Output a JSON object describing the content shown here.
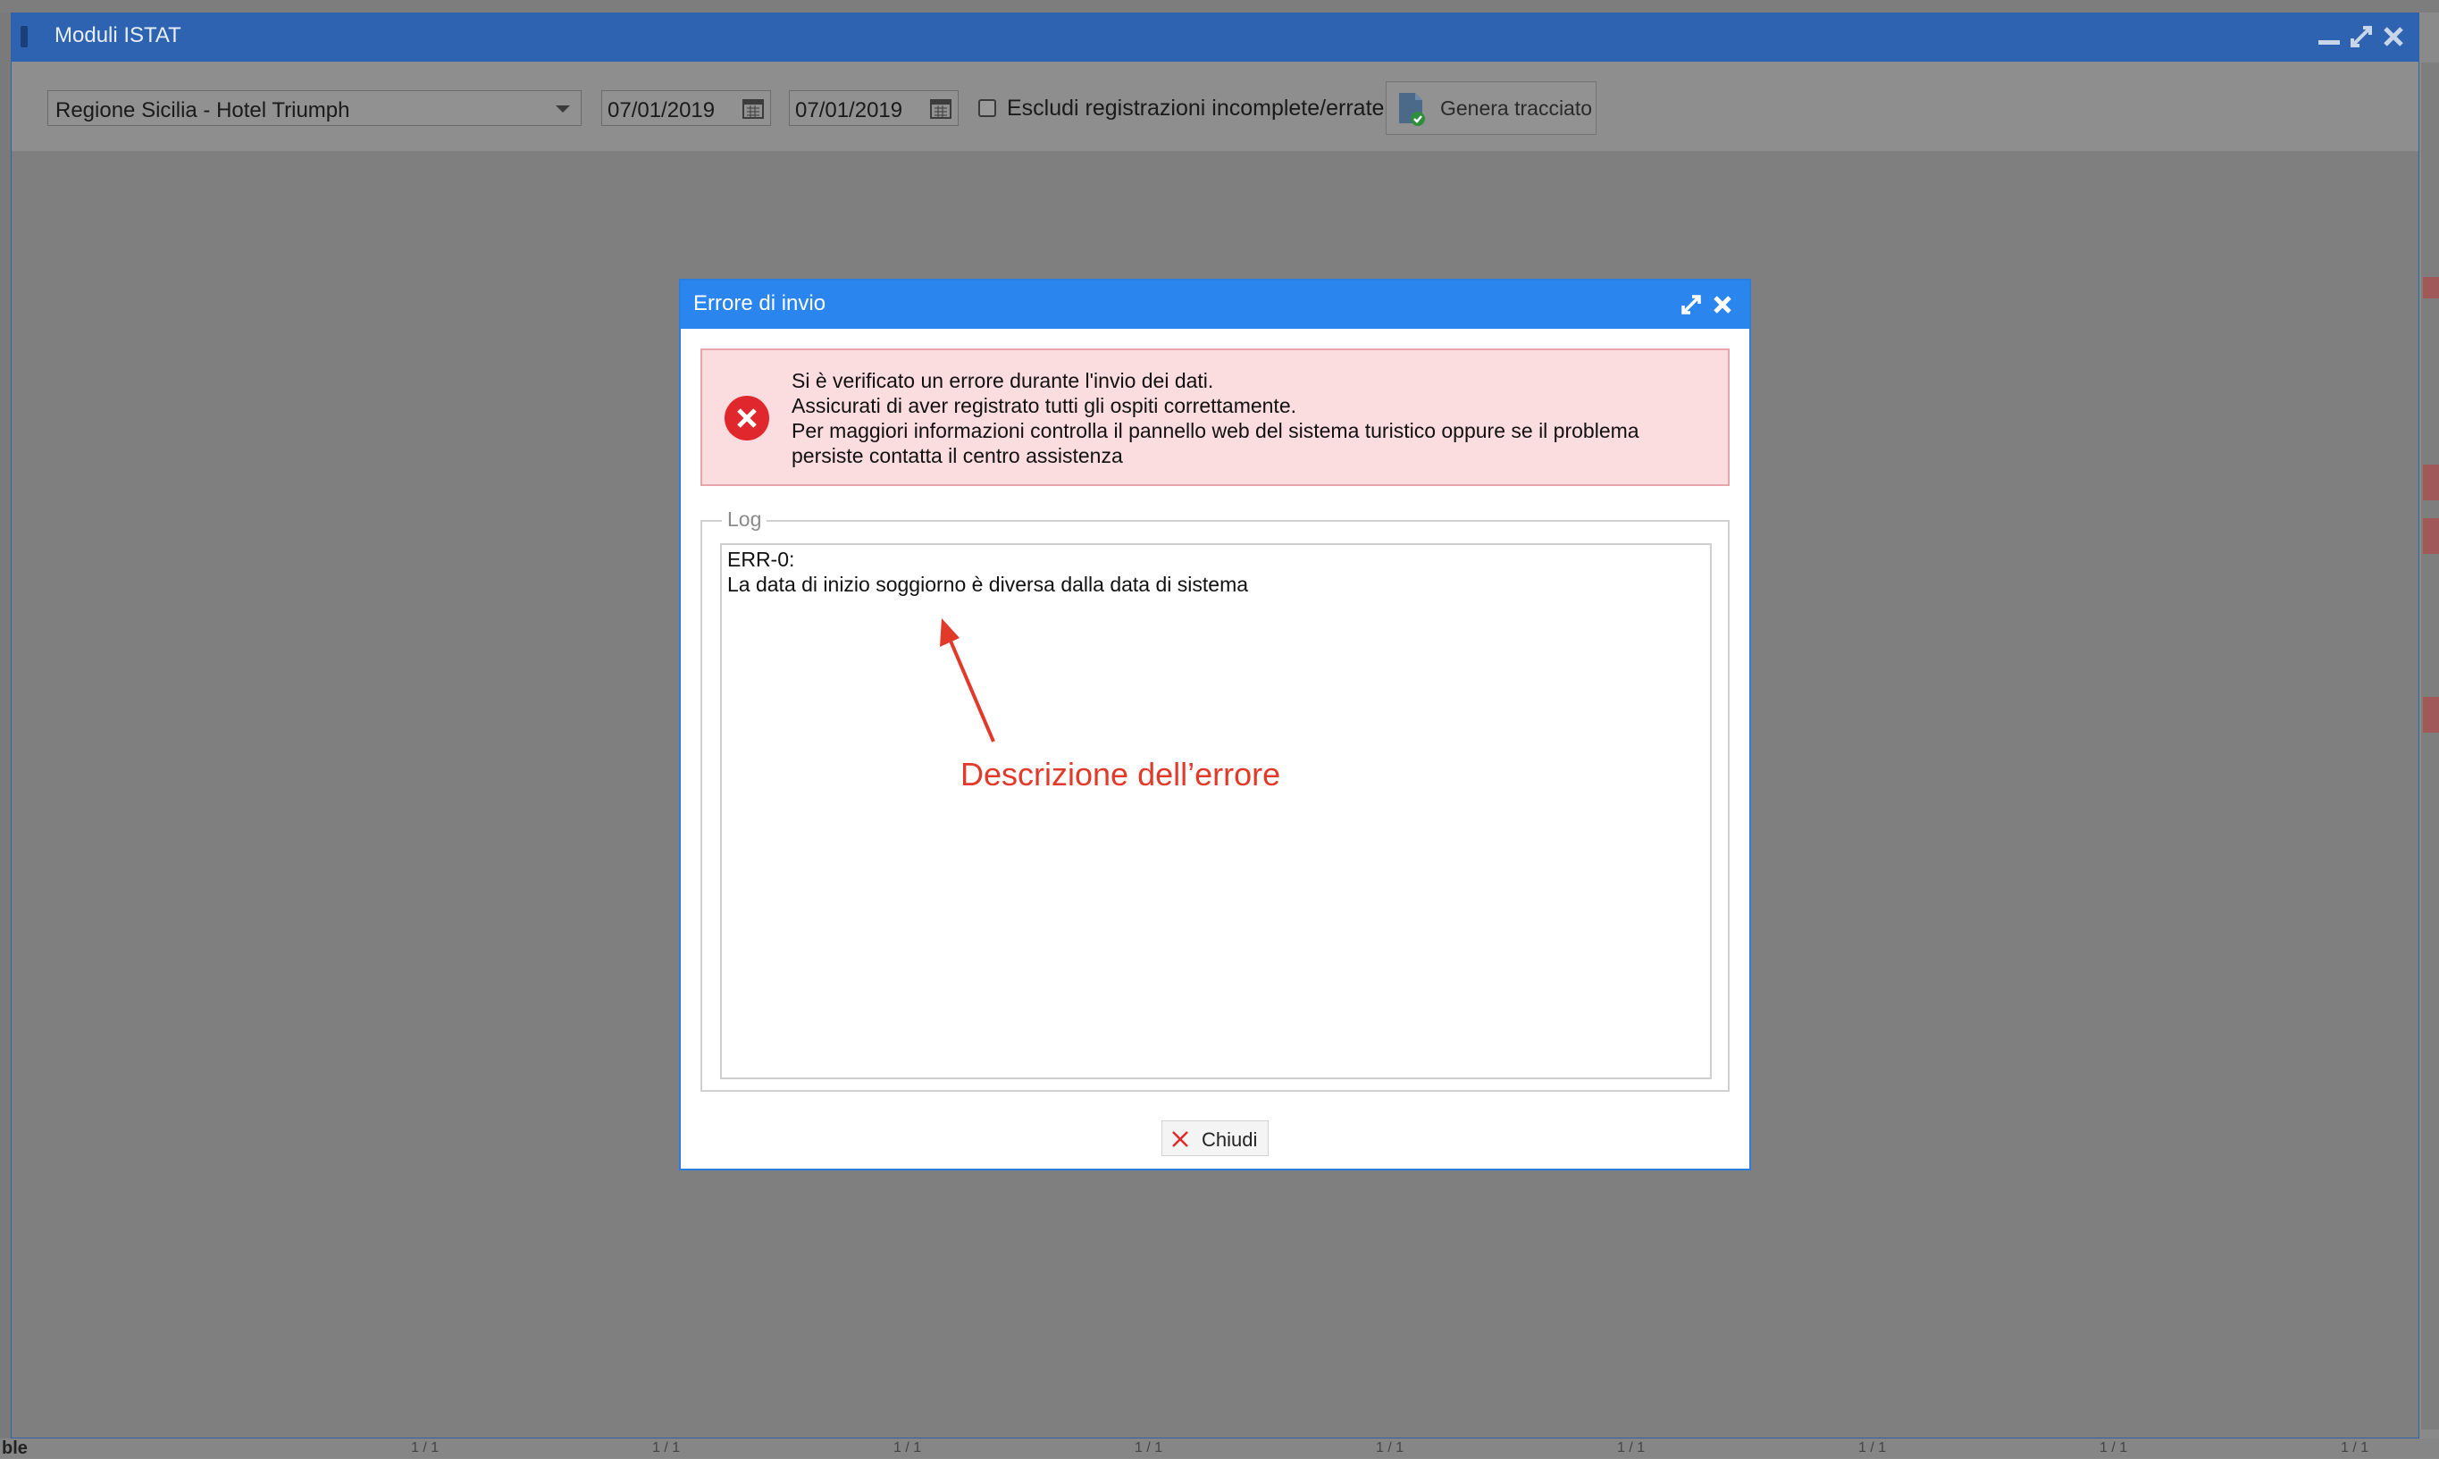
{
  "window": {
    "title": "Moduli ISTAT"
  },
  "toolbar": {
    "structure_select": "Regione Sicilia - Hotel Triumph",
    "date_from": "07/01/2019",
    "date_to": "07/01/2019",
    "exclude_label": "Escludi registrazioni incomplete/errate",
    "generate_label": "Genera tracciato"
  },
  "dialog": {
    "title": "Errore di invio",
    "alert_lines": [
      "Si è verificato un errore durante l'invio dei dati.",
      "Assicurati di aver registrato tutti gli ospiti correttamente.",
      "Per maggiori informazioni controlla il pannello web del sistema turistico oppure se il problema",
      "persiste contatta il centro assistenza"
    ],
    "log_legend": "Log",
    "log_lines": [
      "ERR-0:",
      "La data di inizio soggiorno è diversa dalla data di sistema"
    ],
    "close_label": "Chiudi"
  },
  "annotation": {
    "text": "Descrizione dell’errore"
  },
  "background": {
    "bottom_label": "ble",
    "pager": [
      "1 / 1",
      "1 / 1",
      "1 / 1",
      "1 / 1",
      "1 / 1",
      "1 / 1",
      "1 / 1",
      "1 / 1",
      "1 / 1"
    ]
  },
  "colors": {
    "window_titlebar": "#2d63b1",
    "dialog_titlebar": "#2a86ee",
    "alert_bg": "#fbdcdf",
    "alert_icon": "#e0272d",
    "annotation": "#e23a2a"
  },
  "icons": {
    "calendar": "calendar-icon",
    "generate": "document-check-icon",
    "error": "error-circle-icon",
    "close": "close-icon",
    "expand": "expand-icon"
  }
}
